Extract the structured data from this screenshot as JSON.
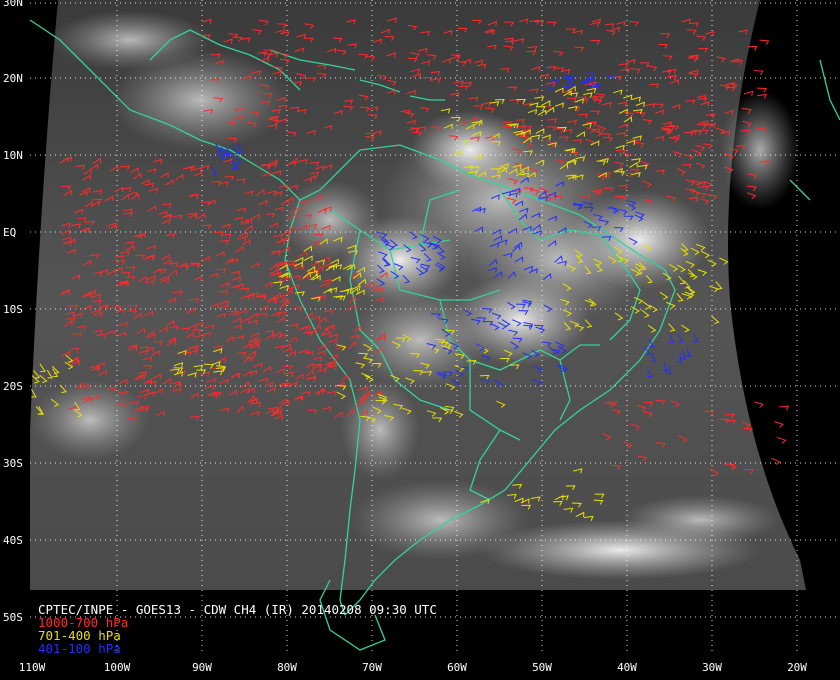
{
  "map": {
    "title": "CPTEC/INPE - GOES13 - CDW CH4 (IR) 20140208 09:30 UTC",
    "legend": [
      {
        "label": "1000-700 hPa",
        "color": "#ff2a2a"
      },
      {
        "label": "701-400 hPa",
        "color": "#e8e000"
      },
      {
        "label": "401-100 hPa",
        "color": "#2030ff"
      }
    ],
    "latitude_labels": [
      "30N",
      "20N",
      "10N",
      "EQ",
      "10S",
      "20S",
      "30S",
      "40S",
      "50S"
    ],
    "longitude_labels": [
      "110W",
      "100W",
      "90W",
      "80W",
      "70W",
      "60W",
      "50W",
      "40W",
      "30W",
      "20W"
    ],
    "coastline_color": "#33d39a",
    "grid_color": "#ffffff"
  }
}
